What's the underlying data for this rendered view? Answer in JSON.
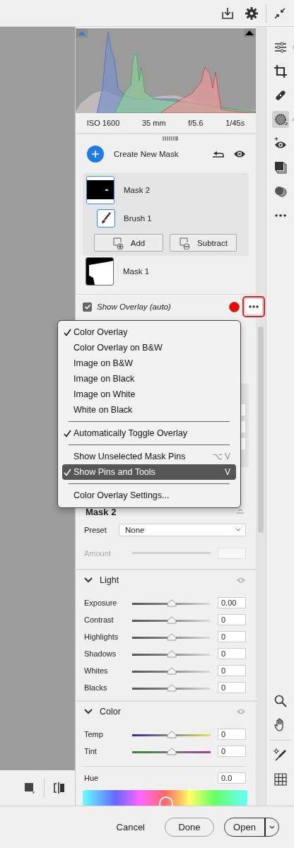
{
  "histogram": {
    "info": [
      "ISO 1600",
      "35 mm",
      "f/5.6",
      "1/45s"
    ]
  },
  "masks": {
    "create_label": "Create New Mask",
    "items": [
      {
        "name": "Mask 2",
        "selected": true,
        "children": [
          {
            "name": "Brush 1",
            "selected": false
          }
        ],
        "buttons": [
          "Add",
          "Subtract"
        ]
      },
      {
        "name": "Mask 1",
        "selected": false
      }
    ]
  },
  "overlay": {
    "label": "Show Overlay (auto)",
    "checked": true,
    "color": "#ff0000"
  },
  "menu": {
    "items": [
      {
        "kind": "item",
        "label": "Color Overlay",
        "checked": true,
        "selected": false
      },
      {
        "kind": "item",
        "label": "Color Overlay on B&W",
        "checked": false,
        "selected": false
      },
      {
        "kind": "item",
        "label": "Image on B&W",
        "checked": false,
        "selected": false
      },
      {
        "kind": "item",
        "label": "Image on Black",
        "checked": false,
        "selected": false
      },
      {
        "kind": "item",
        "label": "Image on White",
        "checked": false,
        "selected": false
      },
      {
        "kind": "item",
        "label": "White on Black",
        "checked": false,
        "selected": false
      },
      {
        "kind": "separator"
      },
      {
        "kind": "item",
        "label": "Automatically Toggle Overlay",
        "checked": true,
        "selected": false
      },
      {
        "kind": "separator"
      },
      {
        "kind": "item",
        "label": "Show Unselected Mask Pins",
        "shortcut": "⌥ V",
        "checked": false,
        "selected": false
      },
      {
        "kind": "item",
        "label": "Show Pins and Tools",
        "shortcut": "V",
        "checked": true,
        "selected": true
      },
      {
        "kind": "separator"
      },
      {
        "kind": "item",
        "label": "Color Overlay Settings...",
        "checked": false,
        "selected": false
      }
    ]
  },
  "mask_panel": {
    "title": "Mask 2",
    "preset": {
      "label": "Preset",
      "value": "None"
    },
    "amount": {
      "label": "Amount",
      "disabled": true
    }
  },
  "sections": [
    {
      "title": "Light",
      "expanded": true,
      "sliders": [
        {
          "kind": "neutral",
          "name": "Exposure",
          "level": 0.5,
          "value": "0.00"
        },
        {
          "kind": "neutral",
          "name": "Contrast",
          "level": 0.5,
          "value": "0"
        },
        {
          "kind": "neutral",
          "name": "Highlights",
          "level": 0.5,
          "value": "0"
        },
        {
          "kind": "neutral",
          "name": "Shadows",
          "level": 0.5,
          "value": "0"
        },
        {
          "kind": "neutral",
          "name": "Whites",
          "level": 0.5,
          "value": "0"
        },
        {
          "kind": "neutral",
          "name": "Blacks",
          "level": 0.5,
          "value": "0"
        }
      ]
    },
    {
      "title": "Color",
      "expanded": true,
      "sliders": [
        {
          "kind": "temp",
          "name": "Temp",
          "level": 0.5,
          "value": "0"
        },
        {
          "kind": "tint",
          "name": "Tint",
          "level": 0.5,
          "value": "0"
        }
      ],
      "hue": {
        "label": "Hue",
        "value": "0.0",
        "level": 0.5
      }
    }
  ],
  "footer": {
    "cancel": "Cancel",
    "done": "Done",
    "open": "Open"
  }
}
